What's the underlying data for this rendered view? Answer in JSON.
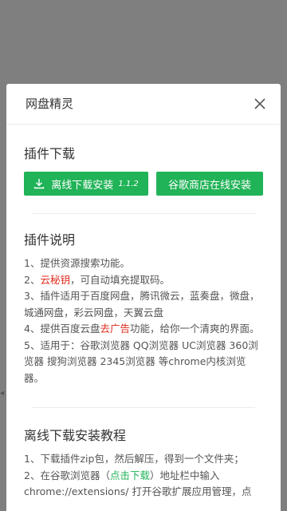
{
  "dialog": {
    "title": "网盘精灵"
  },
  "plugin_download": {
    "title": "插件下载",
    "offline_button_label": "离线下载安装",
    "offline_button_version": "1.1.2",
    "chrome_store_button_label": "谷歌商店在线安装"
  },
  "plugin_description": {
    "title": "插件说明",
    "item1": "1、提供资源搜索功能。",
    "item2_prefix": "2、",
    "item2_highlight": "云秘钥",
    "item2_suffix": "，可自动填充提取码。",
    "item3": "3、插件适用于百度网盘，腾讯微云，蓝奏盘，微盘，城通网盘，彩云网盘，天翼云盘",
    "item4_prefix": "4、提供百度云盘",
    "item4_highlight": "去广告",
    "item4_suffix": "功能，给你一个清爽的界面。",
    "item5": "5、适用于：谷歌浏览器 QQ浏览器 UC浏览器 360浏览器 搜狗浏览器 2345浏览器 等chrome内核浏览器。"
  },
  "offline_tutorial": {
    "title": "离线下载安装教程",
    "step1": "1、下载插件zip包，然后解压，得到一个文件夹；",
    "step2_prefix": "2、在谷歌浏览器（",
    "step2_link": "点击下载",
    "step2_suffix": "）地址栏中输入",
    "step2_line2": "chrome://extensions/ 打开谷歌扩展应用管理，点"
  },
  "colors": {
    "accent_green": "#20b357",
    "highlight_red": "#e02a1d",
    "backdrop": "#7f7f7f"
  }
}
